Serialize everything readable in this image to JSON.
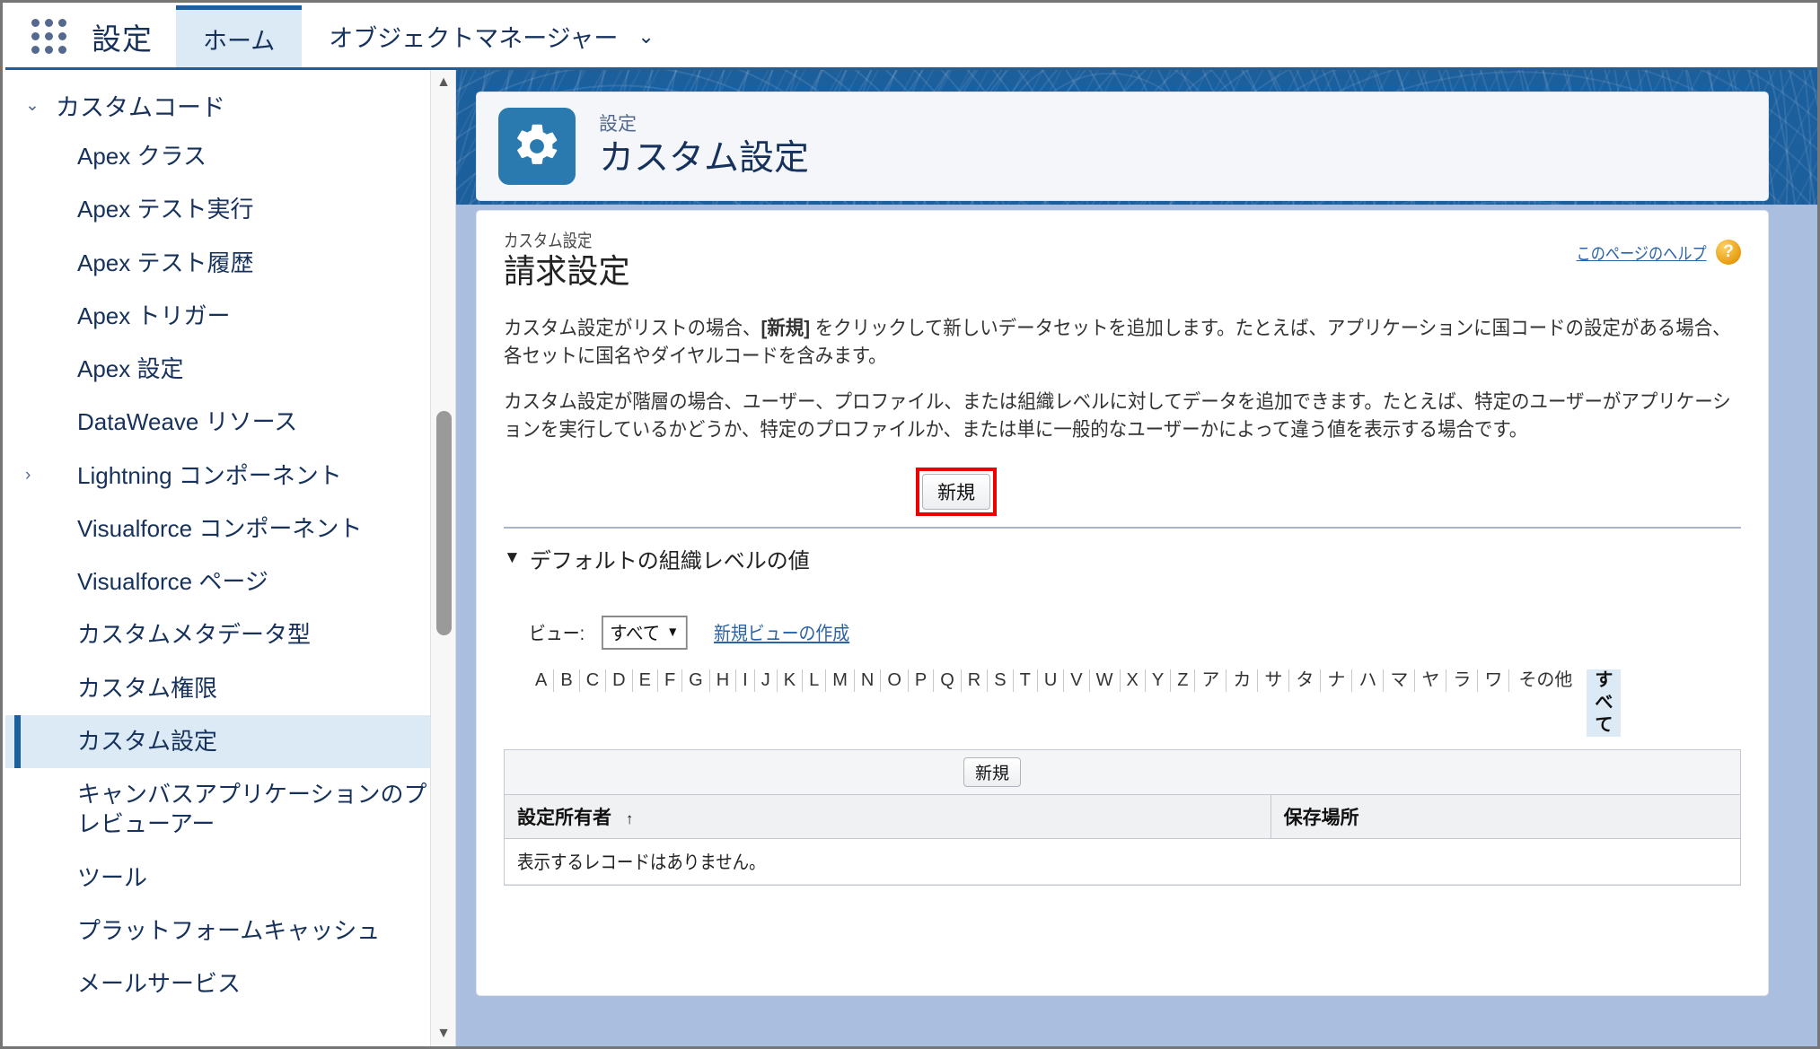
{
  "global_header": {
    "app_launcher_icon": "app-launcher-waffle-icon",
    "setup_label": "設定",
    "tabs": [
      {
        "label": "ホーム",
        "active": true
      },
      {
        "label": "オブジェクトマネージャー",
        "active": false
      }
    ],
    "tab_caret_icon": "chevron-down-icon"
  },
  "sidebar": {
    "group": {
      "label": "カスタムコード",
      "twisty": "⌄"
    },
    "items": [
      {
        "label": "Apex クラス",
        "twisty": "",
        "selected": false
      },
      {
        "label": "Apex テスト実行",
        "twisty": "",
        "selected": false
      },
      {
        "label": "Apex テスト履歴",
        "twisty": "",
        "selected": false
      },
      {
        "label": "Apex トリガー",
        "twisty": "",
        "selected": false
      },
      {
        "label": "Apex 設定",
        "twisty": "",
        "selected": false
      },
      {
        "label": "DataWeave リソース",
        "twisty": "",
        "selected": false
      },
      {
        "label": "Lightning コンポーネント",
        "twisty": "›",
        "selected": false
      },
      {
        "label": "Visualforce コンポーネント",
        "twisty": "",
        "selected": false
      },
      {
        "label": "Visualforce ページ",
        "twisty": "",
        "selected": false
      },
      {
        "label": "カスタムメタデータ型",
        "twisty": "",
        "selected": false
      },
      {
        "label": "カスタム権限",
        "twisty": "",
        "selected": false
      },
      {
        "label": "カスタム設定",
        "twisty": "",
        "selected": true
      },
      {
        "label": "キャンバスアプリケーションのプレビューアー",
        "twisty": "",
        "selected": false
      },
      {
        "label": "ツール",
        "twisty": "",
        "selected": false
      },
      {
        "label": "プラットフォームキャッシュ",
        "twisty": "",
        "selected": false
      },
      {
        "label": "メールサービス",
        "twisty": "",
        "selected": false
      }
    ],
    "scrollbar": {
      "up_icon": "scroll-up-arrow-icon",
      "down_icon": "scroll-down-arrow-icon"
    }
  },
  "page_header": {
    "icon": "gear-icon",
    "eyebrow": "設定",
    "title": "カスタム設定"
  },
  "content": {
    "eyebrow": "カスタム設定",
    "title": "請求設定",
    "help_link": "このページのヘルプ",
    "help_badge": "?",
    "paragraph_1_a": "カスタム設定がリストの場合、",
    "paragraph_1_b": "[新規]",
    "paragraph_1_c": " をクリックして新しいデータセットを追加します。たとえば、アプリケーションに国コードの設定がある場合、各セットに国名やダイヤルコードを含みます。",
    "paragraph_2": "カスタム設定が階層の場合、ユーザー、プロファイル、または組織レベルに対してデータを追加できます。たとえば、特定のユーザーがアプリケーションを実行しているかどうか、特定のプロファイルか、または単に一般的なユーザーかによって違う値を表示する場合です。",
    "new_button": "新規",
    "section_heading": "デフォルトの組織レベルの値",
    "section_triangle": "▼",
    "view_label": "ビュー:",
    "view_value": "すべて",
    "view_caret_icon": "chevron-down-icon",
    "create_view_link": "新規ビューの作成",
    "alpha_filters": [
      "A",
      "B",
      "C",
      "D",
      "E",
      "F",
      "G",
      "H",
      "I",
      "J",
      "K",
      "L",
      "M",
      "N",
      "O",
      "P",
      "Q",
      "R",
      "S",
      "T",
      "U",
      "V",
      "W",
      "X",
      "Y",
      "Z",
      "ア",
      "カ",
      "サ",
      "タ",
      "ナ",
      "ハ",
      "マ",
      "ヤ",
      "ラ",
      "ワ"
    ],
    "alpha_other": "その他",
    "alpha_all": "すべて",
    "list_new_button": "新規",
    "table": {
      "columns": [
        {
          "label": "設定所有者",
          "sort": "↑"
        },
        {
          "label": "保存場所",
          "sort": ""
        }
      ],
      "empty_message": "表示するレコードはありません。"
    }
  },
  "colors": {
    "brand_blue": "#1b5f9e",
    "accent_tile": "#2a7ab0",
    "selected_row": "#dbeaf5",
    "highlight_red": "#ef0000",
    "link_blue": "#2b63a8"
  }
}
